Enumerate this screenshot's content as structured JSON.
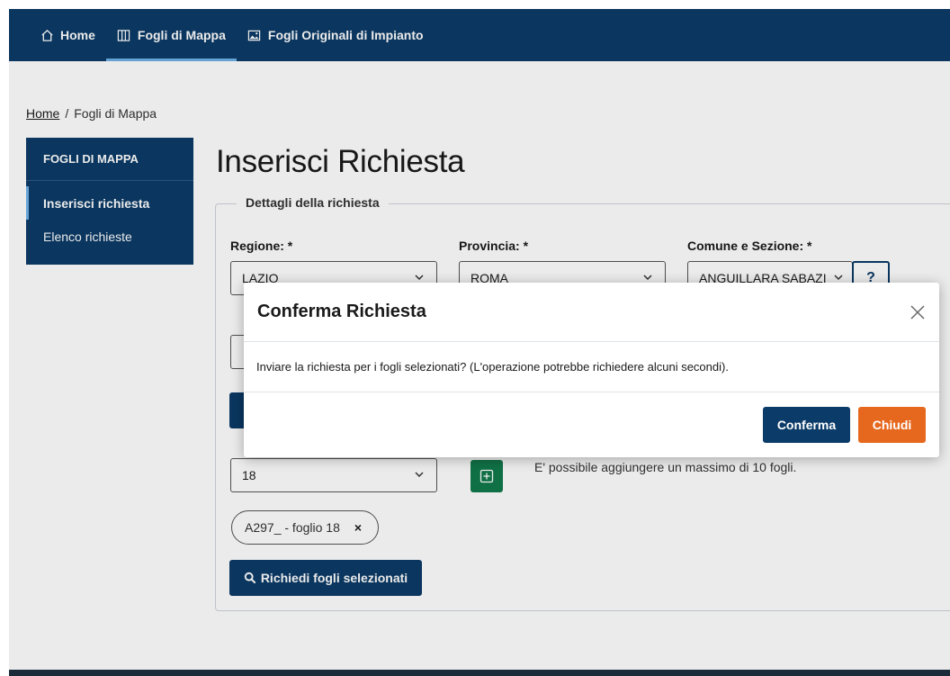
{
  "nav": {
    "items": [
      {
        "label": "Home",
        "icon": "home-icon"
      },
      {
        "label": "Fogli di Mappa",
        "icon": "map-columns-icon"
      },
      {
        "label": "Fogli Originali di Impianto",
        "icon": "image-icon"
      }
    ],
    "active": "Fogli di Mappa"
  },
  "breadcrumb": {
    "home": "Home",
    "separator": "/",
    "current": "Fogli di Mappa"
  },
  "sidebar": {
    "title": "FOGLI DI MAPPA",
    "items": [
      {
        "label": "Inserisci richiesta"
      },
      {
        "label": "Elenco richieste"
      }
    ]
  },
  "main": {
    "title": "Inserisci Richiesta",
    "legend": "Dettagli della richiesta",
    "regione_label": "Regione: *",
    "regione_value": "LAZIO",
    "provincia_label": "Provincia: *",
    "provincia_value": "ROMA",
    "comune_label": "Comune e Sezione: *",
    "comune_value": "ANGUILLARA SABAZI",
    "help_label": "?",
    "foglio_value": "18",
    "info_text": "E' possibile aggiungere un massimo di 10 fogli.",
    "chip_label": "A297_ - foglio 18",
    "chip_remove": "×",
    "request_button": "Richiedi fogli selezionati"
  },
  "modal": {
    "title": "Conferma Richiesta",
    "body": "Inviare la richiesta per i fogli selezionati? (L'operazione potrebbe richiedere alcuni secondi).",
    "confirm": "Conferma",
    "close": "Chiudi"
  },
  "colors": {
    "navy": "#0b3b68",
    "orange": "#e6681e",
    "green": "#127a4b"
  }
}
